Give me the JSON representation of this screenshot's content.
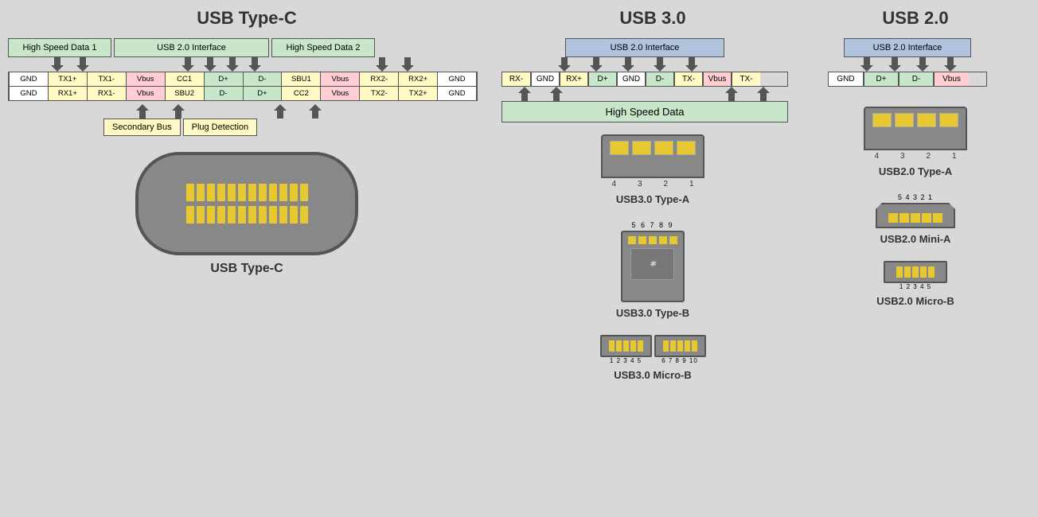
{
  "titles": {
    "typec": "USB Type-C",
    "usb30": "USB 3.0",
    "usb20": "USB 2.0"
  },
  "typec": {
    "groups": {
      "hsd1": "High Speed Data 1",
      "usb20": "USB 2.0 Interface",
      "hsd2": "High Speed Data 2"
    },
    "row1": [
      "GND",
      "TX1+",
      "TX1-",
      "Vbus",
      "CC1",
      "D+",
      "D-",
      "SBU1",
      "Vbus",
      "RX2-",
      "RX2+",
      "GND"
    ],
    "row2": [
      "GND",
      "RX1+",
      "RX1-",
      "Vbus",
      "SBU2",
      "D-",
      "D+",
      "CC2",
      "Vbus",
      "TX2-",
      "TX2+",
      "GND"
    ],
    "row1_colors": [
      "gnd",
      "tx",
      "tx",
      "vbus",
      "cc",
      "dp",
      "dm",
      "sbu",
      "vbus",
      "rx",
      "rx",
      "gnd"
    ],
    "row2_colors": [
      "gnd",
      "rx",
      "rx",
      "vbus",
      "sbu",
      "dm",
      "dp",
      "cc",
      "vbus",
      "tx",
      "tx",
      "gnd"
    ],
    "secondary_bus": "Secondary Bus",
    "plug_detection": "Plug Detection",
    "connector_label": "USB Type-C"
  },
  "usb30": {
    "interface_box": "USB 2.0 Interface",
    "pins": [
      "RX-",
      "GND",
      "RX+",
      "D+",
      "GND",
      "D-",
      "TX-",
      "Vbus",
      "TX-"
    ],
    "pin_colors": [
      "rx",
      "gnd",
      "rx",
      "dp",
      "gnd",
      "dm",
      "tx",
      "vbus",
      "tx"
    ],
    "hsd_label": "High Speed Data",
    "connectors": [
      {
        "label": "USB3.0 Type-A",
        "numbers": "4  3  2  1"
      },
      {
        "label": "USB3.0 Type-B",
        "numbers": "5 6 7 8 9"
      },
      {
        "label": "USB3.0 Micro-B",
        "numbers": "1 2 3 4 5    6 7 8 9 10"
      }
    ]
  },
  "usb20_section": {
    "interface_box": "USB 2.0 Interface",
    "pins": [
      "GND",
      "D+",
      "D-",
      "Vbus"
    ],
    "pin_colors": [
      "gnd",
      "dp",
      "dm",
      "vbus"
    ],
    "connectors": [
      {
        "label": "USB2.0 Type-A",
        "numbers": "4  3  2  1"
      },
      {
        "label": "USB2.0 Mini-A",
        "numbers": "5 4 3 2 1"
      },
      {
        "label": "USB2.0 Micro-B",
        "numbers": "1 2 3 4 5"
      }
    ]
  }
}
